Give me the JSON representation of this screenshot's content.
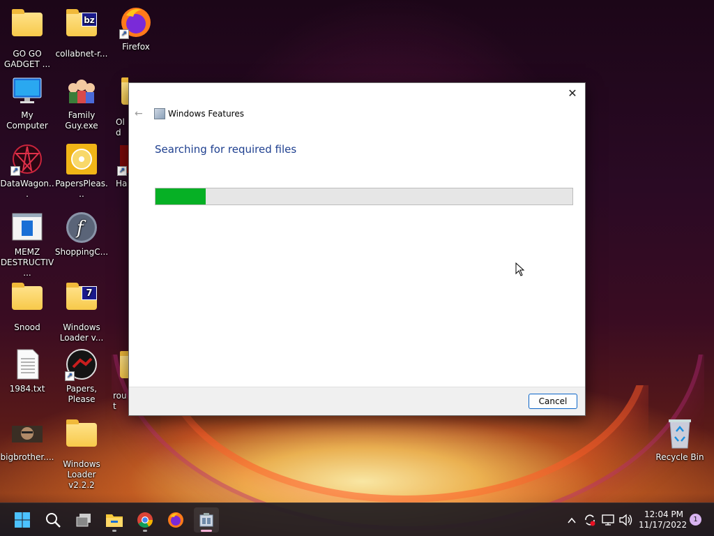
{
  "desktop": {
    "icons": [
      {
        "label": "GO GO GADGET ...",
        "icon": "folder-icon"
      },
      {
        "label": "collabnet-r...",
        "icon": "zip-folder-icon",
        "badge": "bz"
      },
      {
        "label": "Firefox",
        "icon": "firefox-icon"
      },
      {
        "label": "My Computer",
        "icon": "monitor-icon"
      },
      {
        "label": "Family Guy.exe",
        "icon": "family-guy-icon"
      },
      {
        "label": "Old",
        "icon": "folder-icon"
      },
      {
        "label": "DataWagon...",
        "icon": "datawagon-icon"
      },
      {
        "label": "PapersPleas...",
        "icon": "disc-icon"
      },
      {
        "label": "Ha",
        "icon": "app-icon"
      },
      {
        "label": "MEMZ DESTRUCTIV...",
        "icon": "memz-icon"
      },
      {
        "label": "ShoppingC...",
        "icon": "flash-icon"
      },
      {
        "label": "Snood",
        "icon": "folder-icon"
      },
      {
        "label": "Windows Loader v...",
        "icon": "zip-folder-icon",
        "badge": "7"
      },
      {
        "label": "1984.txt",
        "icon": "text-file-icon"
      },
      {
        "label": "Papers, Please",
        "icon": "papers-please-icon"
      },
      {
        "label": "rout",
        "icon": "folder-icon"
      },
      {
        "label": "bigbrother....",
        "icon": "image-icon"
      },
      {
        "label": "Windows Loader v2.2.2",
        "icon": "folder-icon"
      },
      {
        "label": "Recycle Bin",
        "icon": "recycle-bin-icon"
      }
    ]
  },
  "dialog": {
    "title": "Windows Features",
    "heading": "Searching for required files",
    "progress": 0.12,
    "cancel_label": "Cancel",
    "close_glyph": "✕",
    "back_glyph": "←"
  },
  "taskbar": {
    "apps": [
      "start-icon",
      "search-icon",
      "task-view-icon",
      "file-explorer-icon",
      "chrome-icon",
      "firefox-icon",
      "windows-features-icon"
    ],
    "time": "12:04 PM",
    "date": "11/17/2022",
    "notification_count": "1"
  },
  "colors": {
    "progress_fill": "#06b025",
    "heading": "#1e3f8f",
    "button_border": "#0a64c8"
  }
}
